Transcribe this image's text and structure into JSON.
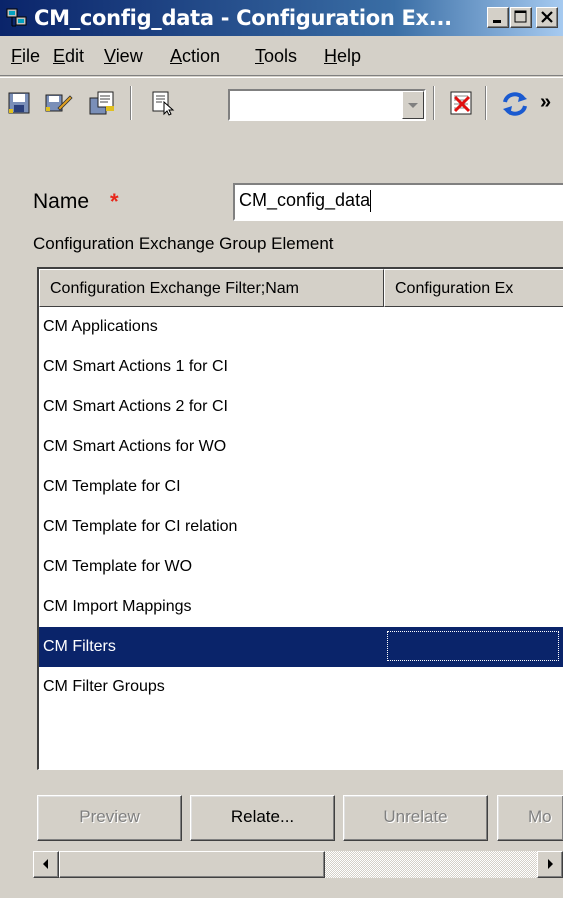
{
  "window": {
    "title": "CM_config_data - Configuration Ex...",
    "app_icon": "network-computers-icon",
    "controls": [
      "minimize-icon",
      "maximize-icon",
      "close-icon"
    ]
  },
  "menu": {
    "items": [
      {
        "label": "File",
        "mnemonic": "F"
      },
      {
        "label": "Edit",
        "mnemonic": "E"
      },
      {
        "label": "View",
        "mnemonic": "V"
      },
      {
        "label": "Action",
        "mnemonic": "A"
      },
      {
        "label": "Tools",
        "mnemonic": "T"
      },
      {
        "label": "Help",
        "mnemonic": "H"
      }
    ]
  },
  "toolbar": {
    "icons": [
      "save-icon",
      "save-as-icon",
      "copy-icon",
      "properties-icon",
      "delete-icon",
      "refresh-icon"
    ],
    "combo_value": "",
    "overflow_label": "»"
  },
  "form": {
    "name_label": "Name",
    "required_marker": "*",
    "name_value": "CM_config_data",
    "group_label": "Configuration Exchange Group Element"
  },
  "table": {
    "columns": [
      "Configuration Exchange Filter;Nam",
      "Configuration Ex"
    ],
    "rows": [
      "CM Applications",
      "CM Smart Actions 1 for CI",
      "CM Smart Actions 2 for CI",
      "CM Smart Actions for WO",
      "CM Template for CI",
      "CM Template for CI relation",
      "CM Template for WO",
      "CM Import Mappings",
      "CM Filters",
      "CM Filter Groups"
    ],
    "selected_row": "CM Filters",
    "selection_color": "#0a246a"
  },
  "buttons": {
    "preview": "Preview",
    "relate": "Relate...",
    "unrelate": "Unrelate",
    "more": "Mo"
  },
  "colors": {
    "titlebar": "#0a246a",
    "face": "#d4d0c8",
    "required": "#e8261a"
  }
}
